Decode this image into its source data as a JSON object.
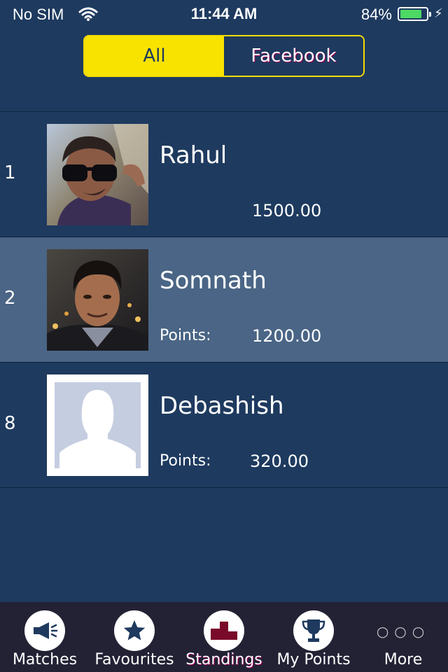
{
  "status_bar": {
    "carrier": "No SIM",
    "time": "11:44 AM",
    "battery_percent": "84%",
    "battery_level": 0.84,
    "wifi_icon": "wifi-icon",
    "charging_icon": "bolt-icon"
  },
  "filter": {
    "options": [
      "All",
      "Facebook"
    ],
    "selected": "All",
    "active_color": "#f8e300"
  },
  "standings": [
    {
      "rank": "1",
      "name": "Rahul",
      "points_label": "",
      "points": "1500.00",
      "highlighted": false,
      "avatar": "user-photo"
    },
    {
      "rank": "2",
      "name": "Somnath",
      "points_label": "Points:",
      "points": "1200.00",
      "highlighted": true,
      "avatar": "user-photo"
    },
    {
      "rank": "8",
      "name": "Debashish",
      "points_label": "Points:",
      "points": "320.00",
      "highlighted": false,
      "avatar": "default-silhouette"
    }
  ],
  "tab_bar": {
    "tabs": [
      {
        "label": "Matches",
        "icon": "megaphone-icon"
      },
      {
        "label": "Favourites",
        "icon": "star-icon"
      },
      {
        "label": "Standings",
        "icon": "podium-icon",
        "active": true
      },
      {
        "label": "My Points",
        "icon": "trophy-icon"
      },
      {
        "label": "More",
        "icon": "more-dots-icon"
      }
    ]
  },
  "colors": {
    "background": "#1e3a5f",
    "highlight_row": "#4a6585",
    "tab_bar": "#232235",
    "accent_yellow": "#f8e300",
    "active_tab_icon": "#7a0a2a"
  }
}
